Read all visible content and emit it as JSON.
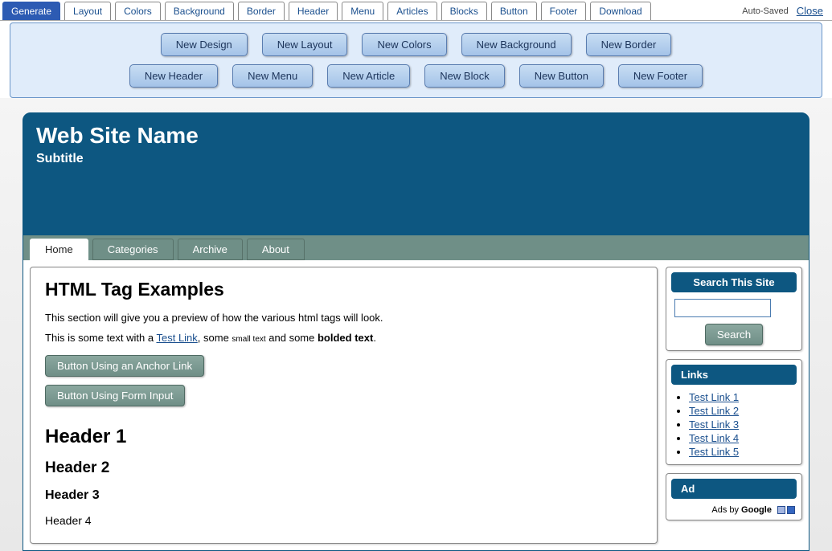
{
  "top_tabs": {
    "active": "Generate",
    "items": [
      "Generate",
      "Layout",
      "Colors",
      "Background",
      "Border",
      "Header",
      "Menu",
      "Articles",
      "Blocks",
      "Button",
      "Footer",
      "Download"
    ]
  },
  "auto_saved": "Auto-Saved",
  "close": "Close",
  "gen_buttons_row1": [
    "New Design",
    "New Layout",
    "New Colors",
    "New Background",
    "New Border"
  ],
  "gen_buttons_row2": [
    "New Header",
    "New Menu",
    "New Article",
    "New Block",
    "New Button",
    "New Footer"
  ],
  "site": {
    "title": "Web Site Name",
    "subtitle": "Subtitle"
  },
  "nav": {
    "active": "Home",
    "items": [
      "Home",
      "Categories",
      "Archive",
      "About"
    ]
  },
  "content": {
    "title": "HTML Tag Examples",
    "para1": "This section will give you a preview of how the various html tags will look.",
    "para2_prefix": "This is some text with a ",
    "para2_link": "Test Link",
    "para2_mid1": ", some ",
    "para2_small": "small text",
    "para2_mid2": " and some ",
    "para2_bold": "bolded text",
    "para2_suffix": ".",
    "btn_anchor": "Button Using an Anchor Link",
    "btn_form": "Button Using Form Input",
    "h1": "Header 1",
    "h2": "Header 2",
    "h3": "Header 3",
    "h4": "Header 4"
  },
  "side": {
    "search_title": "Search This Site",
    "search_btn": "Search",
    "links_title": "Links",
    "links": [
      "Test Link 1",
      "Test Link 2",
      "Test Link 3",
      "Test Link 4",
      "Test Link 5"
    ],
    "ad_title": "Ad",
    "ads_by_prefix": "Ads by ",
    "ads_by_brand": "Google"
  }
}
